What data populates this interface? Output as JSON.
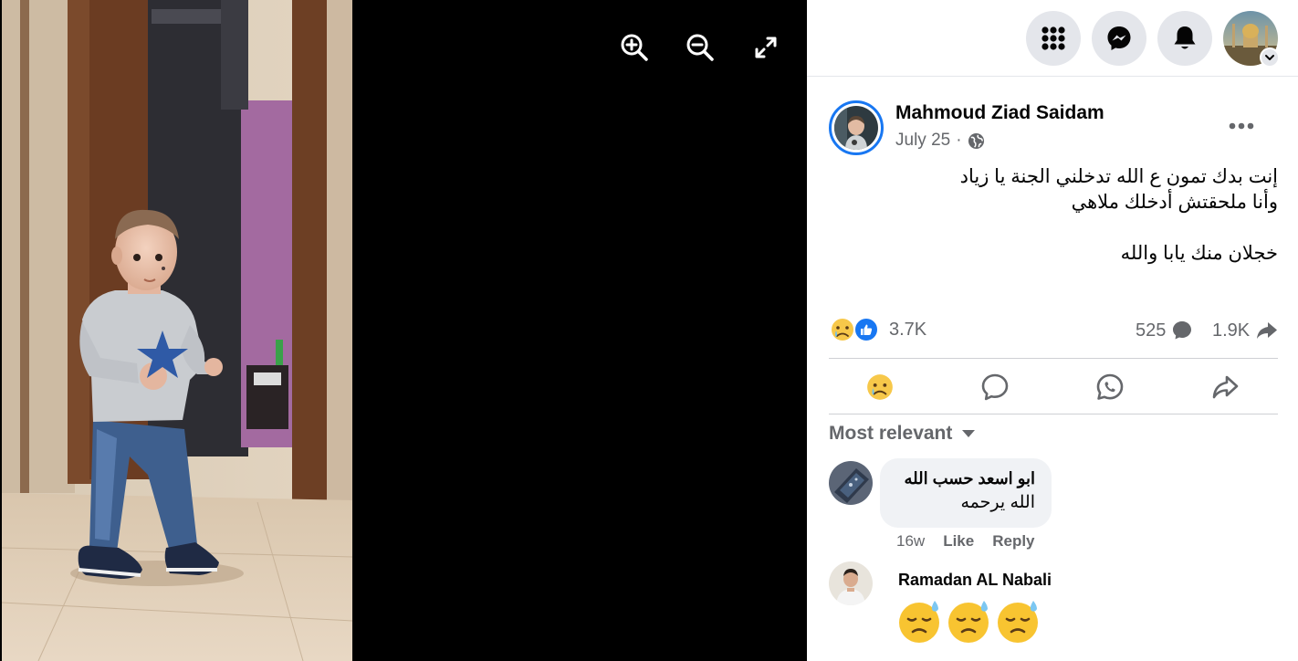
{
  "viewer": {
    "zoom_in": "zoom-in-icon",
    "zoom_out": "zoom-out-icon",
    "fullscreen": "fullscreen-icon"
  },
  "topbar": {
    "menu": "menu-grid-icon",
    "messenger": "messenger-icon",
    "notifications": "bell-icon",
    "account": "account-avatar"
  },
  "post": {
    "author": "Mahmoud Ziad Saidam",
    "date": "July 25",
    "separator": "·",
    "privacy": "globe-icon",
    "text_lines": [
      "إنت بدك تمون ع الله تدخلني الجنة يا زياد",
      "وأنا ملحقتش أدخلك ملاهي",
      "خجلان منك يابا والله"
    ],
    "reactions_count": "3.7K",
    "comments_count": "525",
    "shares_count": "1.9K"
  },
  "comments": {
    "sort_label": "Most relevant",
    "items": [
      {
        "author": "ابو اسعد حسب الله",
        "text": "الله يرحمه",
        "time": "16w",
        "like": "Like",
        "reply": "Reply"
      },
      {
        "author": "Ramadan AL Nabali",
        "emoji_count": 3
      }
    ]
  },
  "colors": {
    "accent": "#1877f2",
    "secondary_text": "#65676b",
    "bubble": "#f0f2f5",
    "button_bg": "#e4e6eb"
  }
}
